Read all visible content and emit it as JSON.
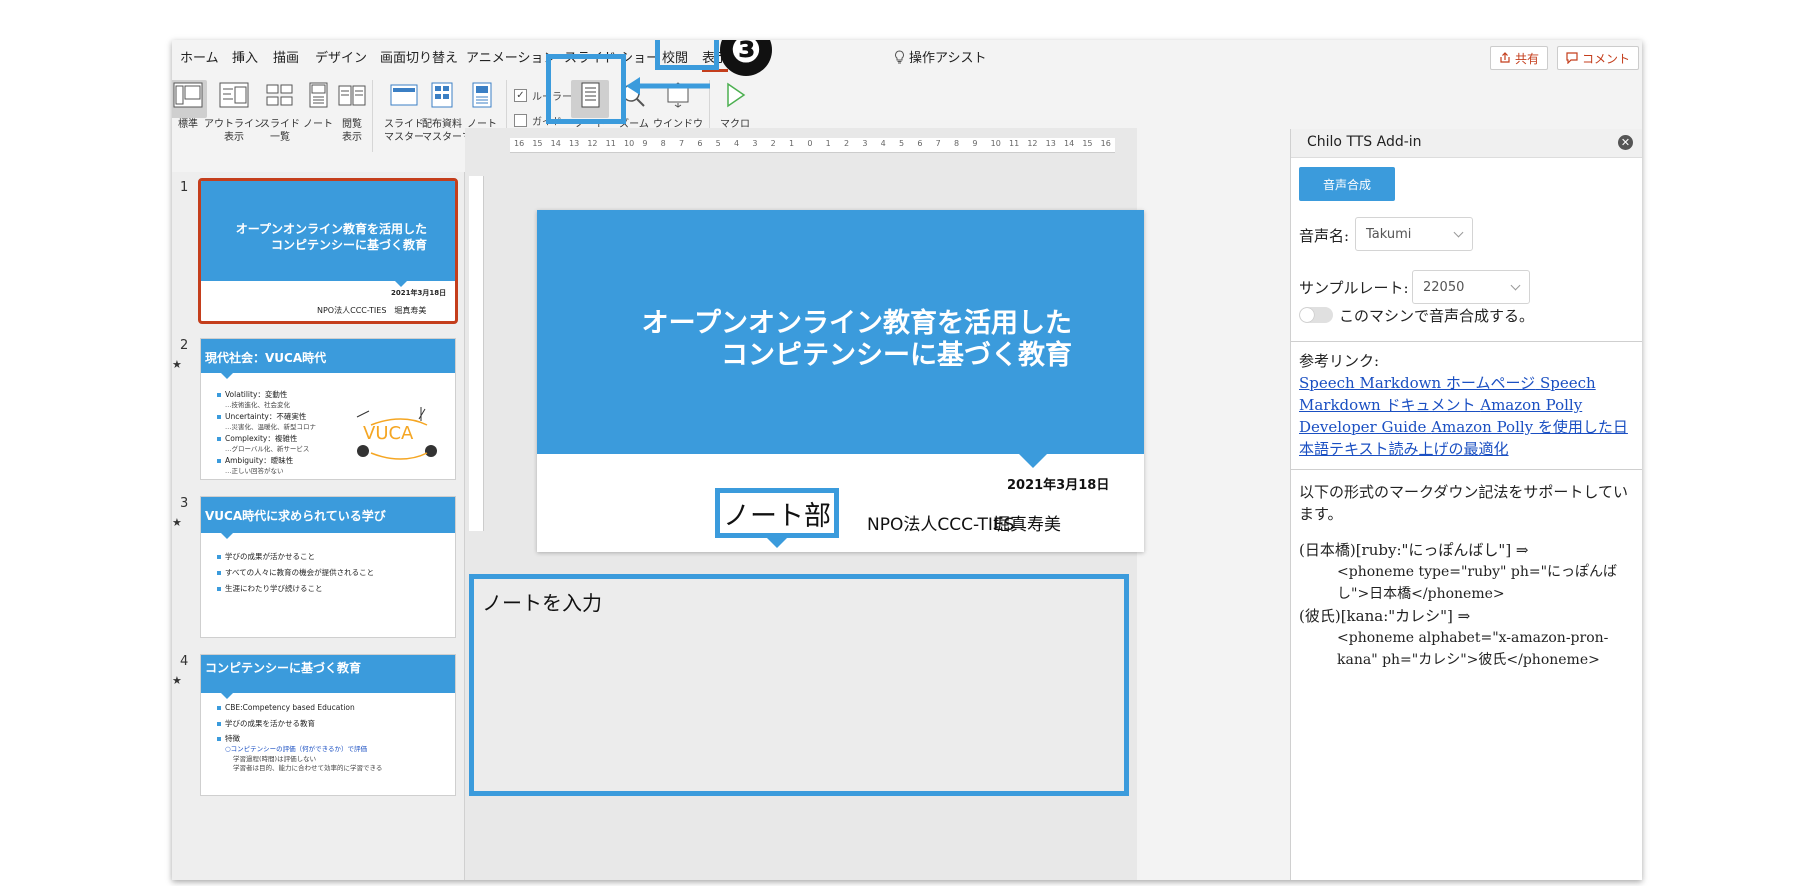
{
  "menu": {
    "items": [
      "ホーム",
      "挿入",
      "描画",
      "デザイン",
      "画面切り替え",
      "アニメーション",
      "スライド ショー",
      "校閲",
      "表示"
    ],
    "assist": "操作アシスト",
    "share": "共有",
    "comment": "コメント"
  },
  "ribbon": {
    "buttons": [
      {
        "label": "標準"
      },
      {
        "label": "アウトライン\n表示"
      },
      {
        "label": "スライド\n一覧"
      },
      {
        "label": "ノート"
      },
      {
        "label": "閲覧\n表示"
      },
      {
        "label": "スライド\nマスター"
      },
      {
        "label": "配布資料\nマスター"
      },
      {
        "label": "ノート\nマスター"
      },
      {
        "label": "ノート"
      },
      {
        "label": "ズーム"
      },
      {
        "label": "ウインドウ\nに合わせる"
      },
      {
        "label": "マクロ"
      }
    ],
    "checkbox_ruler": "ルーラー",
    "checkbox_guide": "ガイド"
  },
  "annotations": {
    "badge": "❸",
    "notes_callout": "ノート部"
  },
  "thumbnails": [
    {
      "num": "1",
      "title": "オープンオンライン教育を活用した\nコンピテンシーに基づく教育",
      "date": "2021年3月18日",
      "org": "NPO法人CCC-TIES　堀真寿美"
    },
    {
      "num": "2",
      "title": "現代社会：VUCA時代",
      "bullets": [
        "Volatility：変動性",
        "Uncertainty：不確実性",
        "Complexity：複雑性",
        "Ambiguity：曖昧性"
      ],
      "subs": [
        "…技術進化、社会変化",
        "…災害化、温暖化、新型コロナ",
        "…グローバル化、新サービス",
        "…正しい回答がない"
      ],
      "vuca": "VUCA"
    },
    {
      "num": "3",
      "title": "VUCA時代に求められている学び",
      "bullets": [
        "学びの成果が活かせること",
        "すべての人々に教育の機会が提供されること",
        "生涯にわたり学び続けること"
      ]
    },
    {
      "num": "4",
      "title": "コンピテンシーに基づく教育",
      "bullets": [
        "CBE:Competency based Education",
        "学びの成果を活かせる教育",
        "特徴"
      ],
      "subs": [
        "○コンピテンシーの評価（何ができるか）で評価",
        "学習過程(時間)は評価しない",
        "学習者は目的、能力に合わせて効率的に学習できる"
      ]
    }
  ],
  "slide": {
    "title_line1": "オープンオンライン教育を活用した",
    "title_line2": "コンピテンシーに基づく教育",
    "date": "2021年3月18日",
    "org": "NPO法人CCC-TIES",
    "author": "堀真寿美",
    "notes_placeholder": "ノートを入力"
  },
  "ruler_ticks": [
    "16",
    "15",
    "14",
    "13",
    "12",
    "11",
    "10",
    "9",
    "8",
    "7",
    "6",
    "5",
    "4",
    "3",
    "2",
    "1",
    "0",
    "1",
    "2",
    "3",
    "4",
    "5",
    "6",
    "7",
    "8",
    "9",
    "10",
    "11",
    "12",
    "13",
    "14",
    "15",
    "16"
  ],
  "addin": {
    "title": "Chilo TTS Add-in",
    "synth_button": "音声合成",
    "voice_label": "音声名:",
    "voice_value": "Takumi",
    "rate_label": "サンプルレート:",
    "rate_value": "22050",
    "toggle_label": "このマシンで音声合成する。",
    "links_label": "参考リンク:",
    "links": [
      "Speech Markdown ホームページ",
      "Speech Markdown ドキュメント",
      "Amazon Polly Developer Guide",
      "Amazon Polly を使用した日本語テキスト読み上げの最適化"
    ],
    "support_text": "以下の形式のマークダウン記法をサポートしています。",
    "example1_src": "(日本橋)[ruby:\"にっぽんばし\"] ⇒",
    "example1_out": "<phoneme type=\"ruby\" ph=\"にっぽんばし\">日本橋</phoneme>",
    "example2_src": "(彼氏)[kana:\"カレシ\"] ⇒",
    "example2_out": "<phoneme alphabet=\"x-amazon-pron-kana\" ph=\"カレシ\">彼氏</phoneme>"
  },
  "colors": {
    "accent": "#3b9bdc",
    "office_red": "#c43e1c"
  }
}
